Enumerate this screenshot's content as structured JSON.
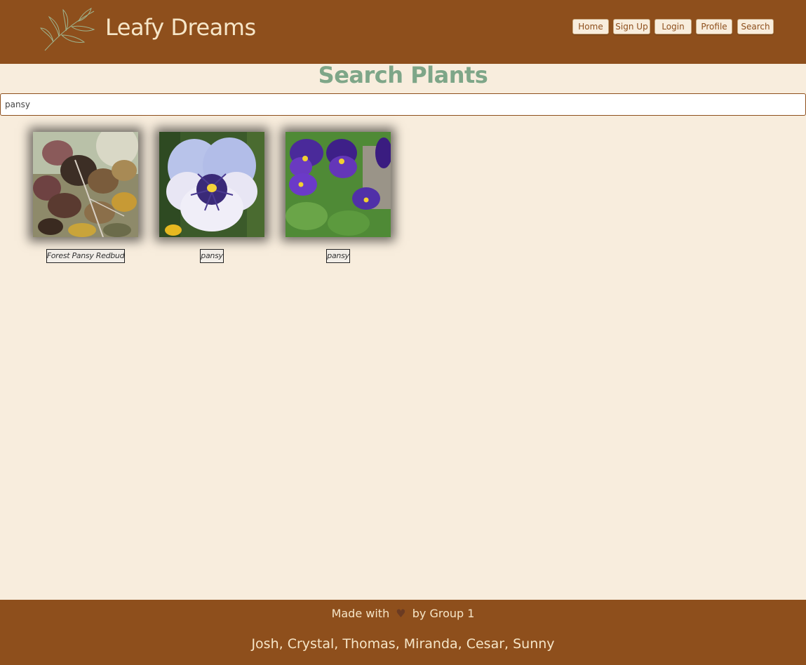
{
  "header": {
    "brand": "Leafy Dreams",
    "logo_icon": "leafy-branch-icon",
    "nav": [
      {
        "label": "Home"
      },
      {
        "label": "Sign Up"
      },
      {
        "label": "Login"
      },
      {
        "label": "Profile"
      },
      {
        "label": "Search"
      }
    ]
  },
  "main": {
    "title": "Search Plants",
    "search_value": "pansy",
    "results": [
      {
        "label": "Forest Pansy Redbud"
      },
      {
        "label": "pansy"
      },
      {
        "label": "pansy"
      }
    ]
  },
  "footer": {
    "made_with_prefix": "Made with",
    "heart_icon": "heart-icon",
    "made_with_suffix": "by Group 1",
    "members": "Josh, Crystal, Thomas, Miranda, Cesar, Sunny"
  },
  "colors": {
    "header_bg": "#8e4f1c",
    "page_bg": "#f8eddd",
    "accent_green": "#7ea688",
    "brand_text": "#f6e6c8"
  }
}
